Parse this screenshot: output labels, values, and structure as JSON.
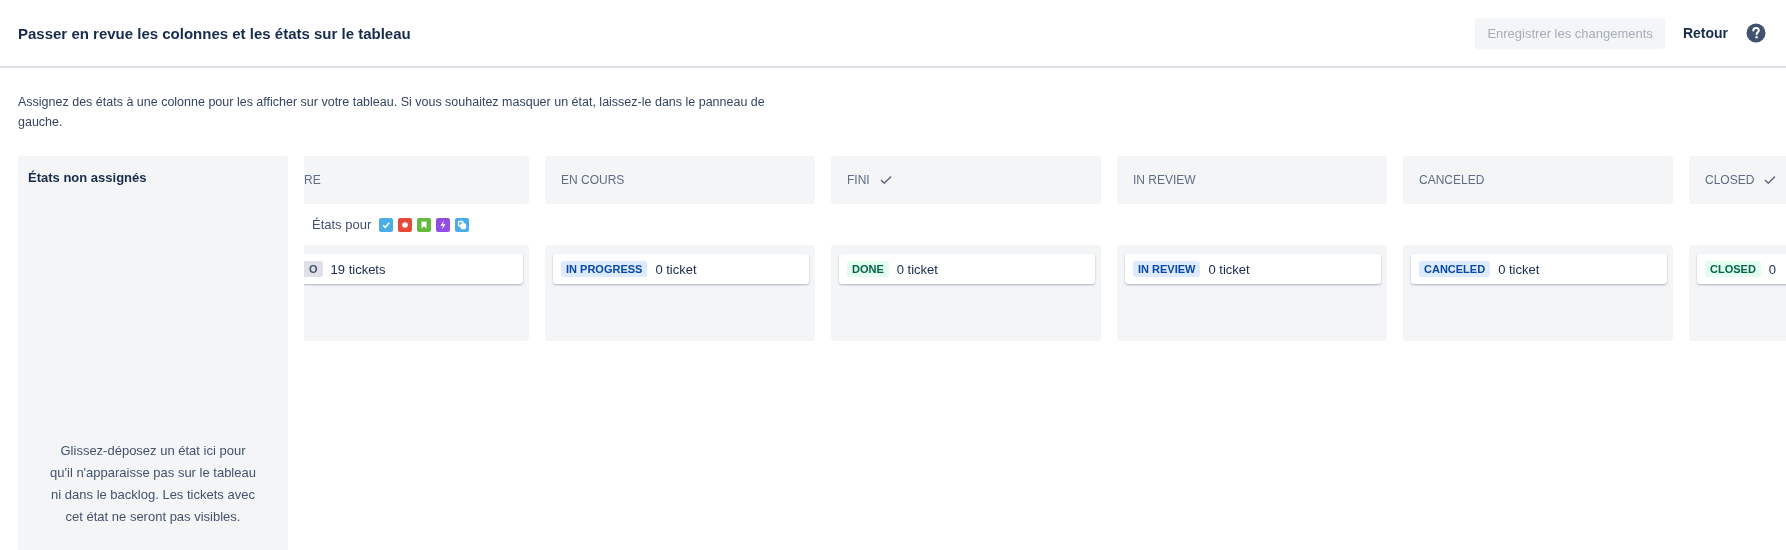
{
  "header": {
    "title": "Passer en revue les colonnes et les états sur le tableau",
    "save_button": {
      "label": "Enregistrer les changements",
      "disabled": true
    },
    "back_link": "Retour"
  },
  "description": "Assignez des états à une colonne pour les afficher sur votre tableau. Si vous souhaitez masquer un état, laissez-le dans le panneau de gauche.",
  "unassigned_panel": {
    "title": "États non assignés",
    "hint": "Glissez-déposez un état ici pour qu'il n'apparaisse pas sur le tableau ni dans le backlog. Les tickets avec cet état ne seront pas visibles."
  },
  "columns": [
    {
      "title": "RE",
      "resolved": false,
      "issue_types_label": "États pour",
      "issue_types": [
        {
          "kind": "task",
          "color": "#4bade8"
        },
        {
          "kind": "bug",
          "color": "#e5493a"
        },
        {
          "kind": "story",
          "color": "#63ba3c"
        },
        {
          "kind": "epic",
          "color": "#904ee2"
        },
        {
          "kind": "subtask",
          "color": "#4bade8"
        }
      ],
      "statuses": [
        {
          "name": "O",
          "kind": "todo",
          "count": "19 tickets"
        }
      ]
    },
    {
      "title": "EN COURS",
      "resolved": false,
      "statuses": [
        {
          "name": "IN PROGRESS",
          "kind": "inprogress",
          "count": "0 ticket"
        }
      ]
    },
    {
      "title": "FINI",
      "resolved": true,
      "statuses": [
        {
          "name": "DONE",
          "kind": "done",
          "count": "0 ticket"
        }
      ]
    },
    {
      "title": "IN REVIEW",
      "resolved": false,
      "statuses": [
        {
          "name": "IN REVIEW",
          "kind": "inprogress",
          "count": "0 ticket"
        }
      ]
    },
    {
      "title": "CANCELED",
      "resolved": false,
      "statuses": [
        {
          "name": "CANCELED",
          "kind": "inprogress",
          "count": "0 ticket"
        }
      ]
    },
    {
      "title": "CLOSED",
      "resolved": true,
      "statuses": [
        {
          "name": "CLOSED",
          "kind": "done",
          "count": "0"
        }
      ]
    }
  ]
}
